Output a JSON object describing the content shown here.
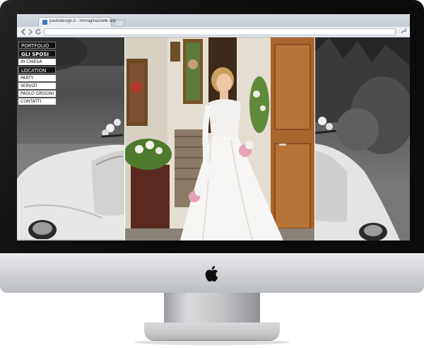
{
  "browser": {
    "tab_title": "paolodesign.it - immaginazione arte",
    "tab_close": "×",
    "new_tab": "",
    "url": ""
  },
  "menu": {
    "items": [
      {
        "label": "PORTFOLIO",
        "style": "black"
      },
      {
        "label": "GLI SPOSI",
        "style": "black"
      },
      {
        "label": "IN CHIESA",
        "style": "white"
      },
      {
        "label": "LOCATION",
        "style": "black"
      },
      {
        "label": "PARTY",
        "style": "white"
      },
      {
        "label": "SERVIZI",
        "style": "white"
      },
      {
        "label": "PAOLO GRISONI",
        "style": "white"
      },
      {
        "label": "CONTATTI",
        "style": "white"
      }
    ]
  },
  "colors": {
    "bezel": "#0b0b0b",
    "chin": "#d6d8db",
    "menu_dark": "#111111",
    "menu_light": "#ffffff"
  },
  "icons": {
    "back": "back-arrow-icon",
    "forward": "forward-arrow-icon",
    "reload": "reload-icon",
    "zoom": "magnifier-plus-icon",
    "apple": "apple-logo-icon",
    "wrench": "wrench-icon"
  }
}
